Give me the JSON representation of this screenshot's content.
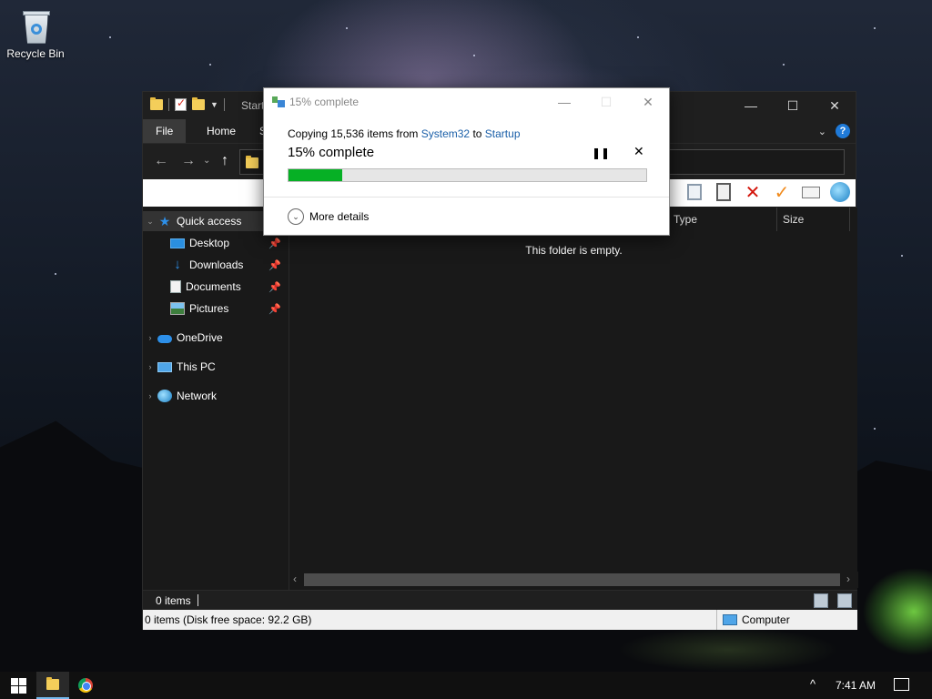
{
  "desktop": {
    "recycle_bin_label": "Recycle Bin"
  },
  "explorer": {
    "title": "Startup",
    "window_controls": {
      "minimize": "—",
      "maximize": "☐",
      "close": "✕"
    },
    "ribbon_tabs": [
      "File",
      "Home",
      "S"
    ],
    "help_label": "?",
    "nav_pane": {
      "quick_access": "Quick access",
      "pinned": [
        "Desktop",
        "Downloads",
        "Documents",
        "Pictures"
      ],
      "onedrive": "OneDrive",
      "this_pc": "This PC",
      "network": "Network"
    },
    "columns": {
      "type": "Type",
      "size": "Size"
    },
    "empty_message": "This folder is empty.",
    "status_items": "0 items",
    "status_disk": "0 items (Disk free space: 92.2 GB)",
    "status_location": "Computer"
  },
  "copy_dialog": {
    "title": "15% complete",
    "copy_prefix": "Copying 15,536 items from ",
    "source": "System32",
    "to_word": " to ",
    "destination": "Startup",
    "progress_text": "15% complete",
    "progress_fraction": 0.15,
    "pause_glyph": "❚❚",
    "cancel_glyph": "✕",
    "more_details": "More details",
    "progress_color": "#06b025"
  },
  "taskbar": {
    "time": "7:41 AM",
    "tray_up_glyph": "^"
  }
}
